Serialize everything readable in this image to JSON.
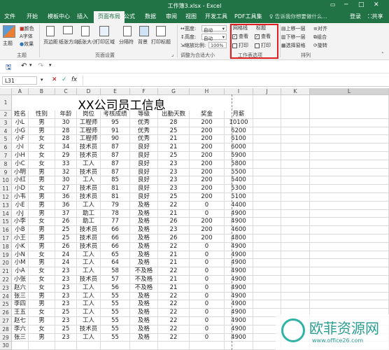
{
  "app": {
    "doc_title": "工作簿3.xlsx - Excel",
    "login": "登录",
    "share": "共享",
    "tabs": [
      "文件",
      "开始",
      "模板中心",
      "插入",
      "页面布局",
      "公式",
      "数据",
      "审阅",
      "视图",
      "开发工具",
      "PDF工具集"
    ],
    "active_tab": "页面布局",
    "tell_me": "告诉我你想要做什么..."
  },
  "ribbon": {
    "themes": {
      "main": "主题",
      "colors": "颜色",
      "fonts": "字体",
      "effects": "效果",
      "group": "主题"
    },
    "page_setup": {
      "items": [
        "页边距",
        "纸张方向",
        "纸张大小",
        "打印区域",
        "分隔符",
        "背景",
        "打印标题"
      ],
      "group": "页面设置"
    },
    "scale": {
      "width_label": "宽度:",
      "width_value": "自动",
      "height_label": "高度:",
      "height_value": "自动",
      "zoom_label": "缩放比例:",
      "zoom_value": "100%",
      "group": "调整为合适大小"
    },
    "sheet_options": {
      "gridlines": "网格线",
      "headings": "标题",
      "view": "查看",
      "print": "打印",
      "view_gridlines_checked": true,
      "view_headings_checked": true,
      "print_gridlines_checked": false,
      "print_headings_checked": false,
      "group": "工作表选项"
    },
    "arrange": {
      "forward": "上移一层",
      "backward": "下移一层",
      "selection_pane": "选择窗格",
      "align": "对齐",
      "group_btn": "组合",
      "rotate": "旋转",
      "group": "排列"
    }
  },
  "formula_bar": {
    "name_box": "L31",
    "fx": "fx",
    "value": ""
  },
  "grid": {
    "columns": [
      "A",
      "B",
      "C",
      "D",
      "E",
      "F",
      "G",
      "H",
      "I",
      "J",
      "K",
      "L"
    ],
    "active_column": "L",
    "row_numbers": [
      "1",
      "2",
      "3",
      "4",
      "5",
      "6",
      "7",
      "8",
      "9",
      "10",
      "11",
      "12",
      "13",
      "14",
      "15",
      "16",
      "17",
      "18",
      "19",
      "20",
      "21",
      "22",
      "23",
      "24",
      "25",
      "26",
      "27",
      "28",
      "29",
      "30"
    ],
    "title": "XX公司员工信息",
    "headers": [
      "姓名",
      "性别",
      "年龄",
      "岗位",
      "考核成绩",
      "等级",
      "出勤天数",
      "奖金",
      "月薪"
    ],
    "rows": [
      [
        "小L",
        "男",
        "30",
        "工程师",
        "95",
        "优秀",
        "28",
        "200",
        "10100"
      ],
      [
        "小G",
        "男",
        "28",
        "工程师",
        "91",
        "优秀",
        "25",
        "200",
        "6200"
      ],
      [
        "小F",
        "女",
        "28",
        "工程师",
        "90",
        "优秀",
        "21",
        "200",
        "6100"
      ],
      [
        "小I",
        "女",
        "34",
        "技术员",
        "87",
        "良好",
        "21",
        "200",
        "6000"
      ],
      [
        "小H",
        "女",
        "29",
        "技术员",
        "87",
        "良好",
        "25",
        "200",
        "5900"
      ],
      [
        "小C",
        "女",
        "33",
        "工人",
        "87",
        "良好",
        "23",
        "200",
        "5800"
      ],
      [
        "小明",
        "男",
        "32",
        "技术员",
        "87",
        "良好",
        "23",
        "200",
        "5500"
      ],
      [
        "小红",
        "男",
        "30",
        "工人",
        "85",
        "良好",
        "23",
        "200",
        "5400"
      ],
      [
        "小D",
        "女",
        "27",
        "技术员",
        "81",
        "良好",
        "23",
        "200",
        "5300"
      ],
      [
        "小韦",
        "男",
        "36",
        "技术员",
        "81",
        "良好",
        "25",
        "200",
        "5100"
      ],
      [
        "小E",
        "男",
        "36",
        "工人",
        "79",
        "及格",
        "22",
        "0",
        "4400"
      ],
      [
        "小J",
        "男",
        "37",
        "助工",
        "78",
        "及格",
        "21",
        "0",
        "4900"
      ],
      [
        "小李",
        "女",
        "26",
        "助工",
        "77",
        "及格",
        "26",
        "200",
        "4900"
      ],
      [
        "小B",
        "男",
        "25",
        "技术员",
        "66",
        "及格",
        "23",
        "200",
        "4600"
      ],
      [
        "小王",
        "男",
        "25",
        "技术员",
        "66",
        "及格",
        "26",
        "200",
        "4800"
      ],
      [
        "小K",
        "男",
        "26",
        "技术员",
        "66",
        "及格",
        "22",
        "0",
        "4900"
      ],
      [
        "小N",
        "女",
        "24",
        "工人",
        "65",
        "及格",
        "21",
        "0",
        "4900"
      ],
      [
        "小M",
        "男",
        "24",
        "工人",
        "64",
        "及格",
        "21",
        "0",
        "4900"
      ],
      [
        "小A",
        "女",
        "23",
        "工人",
        "58",
        "不及格",
        "22",
        "0",
        "4900"
      ],
      [
        "小张",
        "女",
        "23",
        "技术员",
        "57",
        "不及格",
        "21",
        "0",
        "4900"
      ],
      [
        "赵六",
        "女",
        "23",
        "工人",
        "56",
        "不及格",
        "21",
        "0",
        "4900"
      ],
      [
        "张三",
        "男",
        "23",
        "工人",
        "55",
        "及格",
        "22",
        "0",
        "4900"
      ],
      [
        "李四",
        "男",
        "23",
        "工人",
        "55",
        "及格",
        "22",
        "0",
        "4900"
      ],
      [
        "王五",
        "女",
        "25",
        "工人",
        "55",
        "及格",
        "22",
        "0",
        "4900"
      ],
      [
        "赵七",
        "男",
        "23",
        "工人",
        "55",
        "及格",
        "22",
        "0",
        "4900"
      ],
      [
        "李六",
        "女",
        "25",
        "技术员",
        "55",
        "及格",
        "22",
        "0",
        "4900"
      ],
      [
        "张三",
        "男",
        "23",
        "工人",
        "55",
        "及格",
        "22",
        "0",
        "4900"
      ]
    ]
  },
  "watermark": {
    "text": "欧菲资源网",
    "url": "www.office26.com"
  },
  "colors": {
    "excel_green": "#217346",
    "highlight_red": "#e02020"
  }
}
